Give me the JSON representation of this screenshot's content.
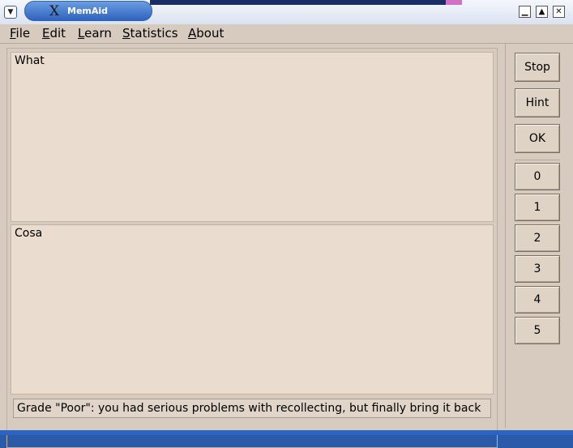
{
  "window": {
    "title": "MemAid",
    "menu_icon": "chevron-down-icon",
    "controls": {
      "minimize": "minimize-icon",
      "maximize": "maximize-icon",
      "close": "close-icon"
    }
  },
  "menu": [
    "File",
    "Edit",
    "Learn",
    "Statistics",
    "About"
  ],
  "question": "What",
  "answer": "Cosa",
  "status": "Grade \"Poor\": you had serious problems with recollecting, but finally bring it back",
  "buttons": {
    "stop": "Stop",
    "hint": "Hint",
    "ok": "OK"
  },
  "grades": [
    "0",
    "1",
    "2",
    "3",
    "4",
    "5"
  ],
  "colors": {
    "window_bg": "#d6cbbe",
    "text_area_bg": "#eaddcf",
    "titlebar_accent": "#2f63bd"
  }
}
